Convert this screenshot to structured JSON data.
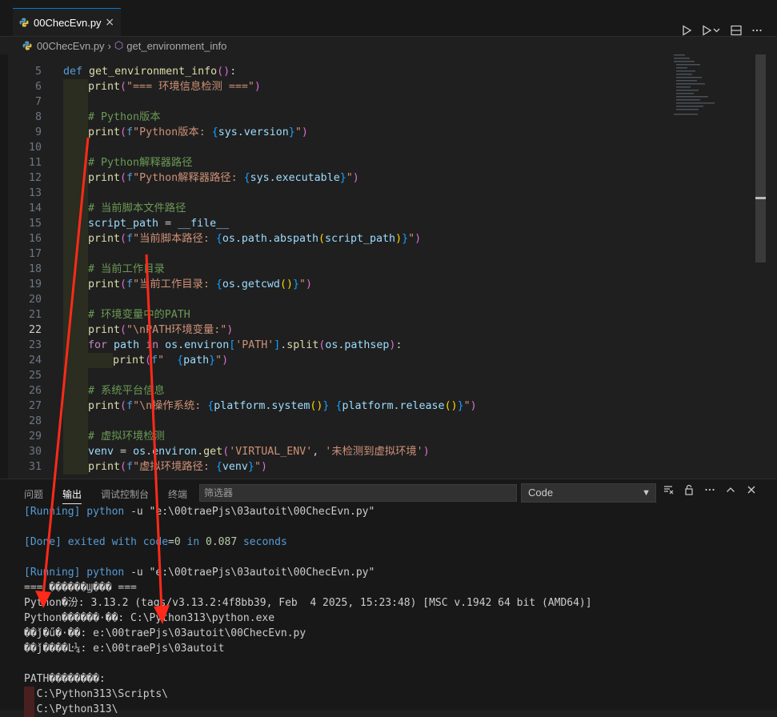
{
  "tab": {
    "label": "00ChecEvn.py",
    "close": "×"
  },
  "breadcrumb": {
    "file": "00ChecEvn.py",
    "symbol": "get_environment_info"
  },
  "code": {
    "current_line": "22",
    "lines": [
      {
        "n": "5",
        "text": "def get_environment_info():"
      },
      {
        "n": "6",
        "text": "print(\"=== 环境信息检测 ===\")"
      },
      {
        "n": "7",
        "text": ""
      },
      {
        "n": "8",
        "text": "# Python版本"
      },
      {
        "n": "9",
        "text": "print(f\"Python版本: {sys.version}\")"
      },
      {
        "n": "10",
        "text": ""
      },
      {
        "n": "11",
        "text": "# Python解释器路径"
      },
      {
        "n": "12",
        "text": "print(f\"Python解释器路径: {sys.executable}\")"
      },
      {
        "n": "13",
        "text": ""
      },
      {
        "n": "14",
        "text": "# 当前脚本文件路径"
      },
      {
        "n": "15",
        "text": "script_path = __file__"
      },
      {
        "n": "16",
        "text": "print(f\"当前脚本路径: {os.path.abspath(script_path)}\")"
      },
      {
        "n": "17",
        "text": ""
      },
      {
        "n": "18",
        "text": "# 当前工作目录"
      },
      {
        "n": "19",
        "text": "print(f\"当前工作目录: {os.getcwd()}\")"
      },
      {
        "n": "20",
        "text": ""
      },
      {
        "n": "21",
        "text": "# 环境变量中的PATH"
      },
      {
        "n": "22",
        "text": "print(\"\\nPATH环境变量:\")"
      },
      {
        "n": "23",
        "text": "for path in os.environ['PATH'].split(os.pathsep):"
      },
      {
        "n": "24",
        "text": "print(f\"  {path}\")"
      },
      {
        "n": "25",
        "text": ""
      },
      {
        "n": "26",
        "text": "# 系统平台信息"
      },
      {
        "n": "27",
        "text": "print(f\"\\n操作系统: {platform.system()} {platform.release()}\")"
      },
      {
        "n": "28",
        "text": ""
      },
      {
        "n": "29",
        "text": "# 虚拟环境检测"
      },
      {
        "n": "30",
        "text": "venv = os.environ.get('VIRTUAL_ENV', '未检测到虚拟环境')"
      },
      {
        "n": "31",
        "text": "print(f\"虚拟环境路径: {venv}\")"
      }
    ]
  },
  "panel": {
    "tabs": [
      "问题",
      "输出",
      "调试控制台",
      "终端"
    ],
    "active_tab": "输出",
    "filter_placeholder": "筛选器",
    "channel": "Code",
    "output": [
      "[Running] python -u \"e:\\00traePjs\\03autoit\\00ChecEvn.py\"",
      "",
      "[Done] exited with code=0 in 0.087 seconds",
      "",
      "[Running] python -u \"e:\\00traePjs\\03autoit\\00ChecEvn.py\"",
      "=== ������Ϣ��� ===",
      "Python�汾: 3.13.2 (tags/v3.13.2:4f8bb39, Feb  4 2025, 15:23:48) [MSC v.1942 64 bit (AMD64)]",
      "Python������·��: C:\\Python313\\python.exe",
      "��ǰ�ű�·��: e:\\00traePjs\\03autoit\\00ChecEvn.py",
      "��ǰ����Ŀ¼: e:\\00traePjs\\03autoit",
      "",
      "PATH��������:",
      "  C:\\Python313\\Scripts\\",
      "  C:\\Python313\\"
    ]
  },
  "colors": {
    "accent": "#0078d4",
    "annotation_arrow": "#ff2a1a"
  }
}
